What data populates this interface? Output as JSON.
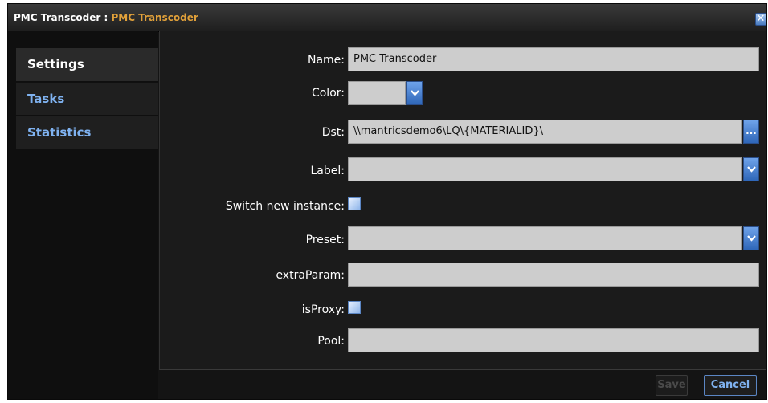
{
  "window": {
    "title_main": "PMC Transcoder : ",
    "title_sub": "PMC Transcoder",
    "close_label": "✕"
  },
  "sidebar": {
    "items": [
      {
        "label": "Settings",
        "active": true
      },
      {
        "label": "Tasks",
        "active": false
      },
      {
        "label": "Statistics",
        "active": false
      }
    ]
  },
  "form": {
    "name": {
      "label": "Name:",
      "value": "PMC Transcoder"
    },
    "color": {
      "label": "Color:",
      "value": ""
    },
    "dst": {
      "label": "Dst:",
      "value": "\\\\mantricsdemo6\\LQ\\{MATERIALID}\\",
      "browse_label": "..."
    },
    "label": {
      "label": "Label:",
      "value": ""
    },
    "switch_new_instance": {
      "label": "Switch new instance:",
      "checked": false
    },
    "preset": {
      "label": "Preset:",
      "value": ""
    },
    "extra_param": {
      "label": "extraParam:",
      "value": ""
    },
    "is_proxy": {
      "label": "isProxy:",
      "checked": false
    },
    "pool": {
      "label": "Pool:",
      "value": ""
    }
  },
  "footer": {
    "save_label": "Save",
    "cancel_label": "Cancel"
  },
  "colors": {
    "accent": "#7fb2f0",
    "title_accent": "#e0a03a",
    "field_bg": "#cdcdcd"
  }
}
